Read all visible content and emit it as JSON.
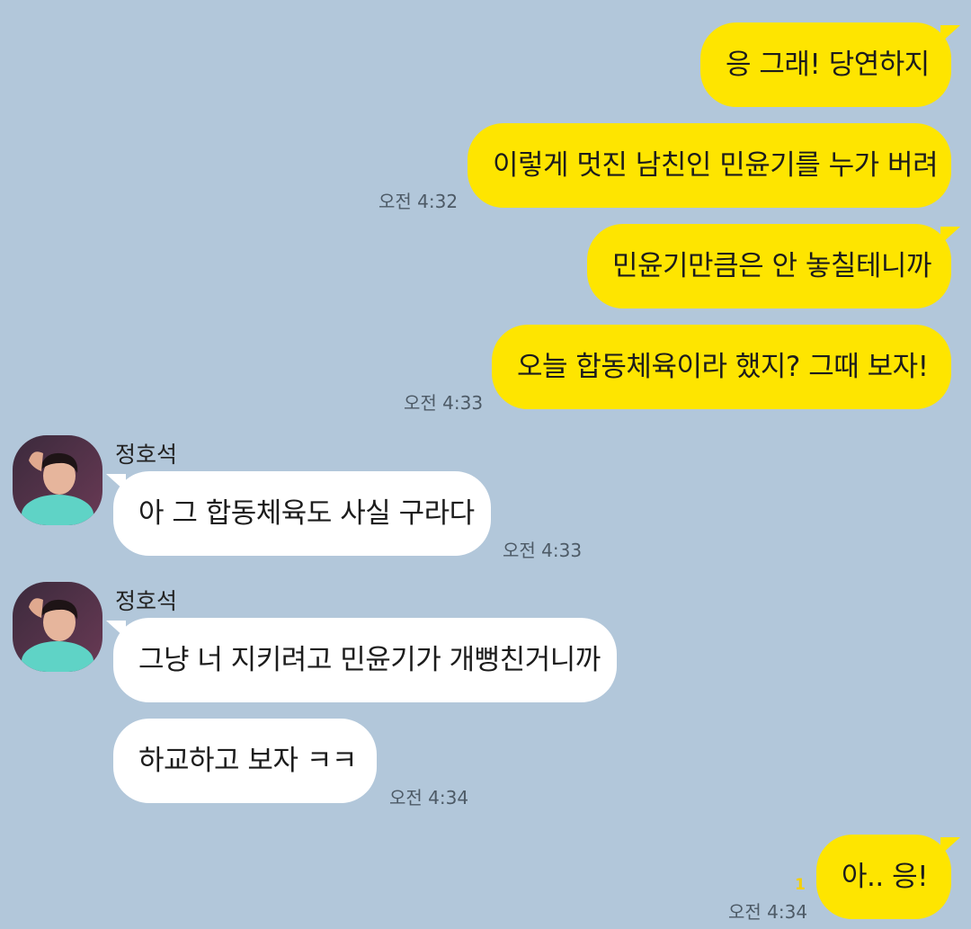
{
  "messages": {
    "m1": {
      "text": "응 그래!  당연하지"
    },
    "m2": {
      "text": "이렇게 멋진 남친인 민윤기를 누가 버려",
      "time": "오전 4:32"
    },
    "m3": {
      "text": "민윤기만큼은 안 놓칠테니까"
    },
    "m4": {
      "text": "오늘 합동체육이라 했지?  그때 보자!",
      "time": "오전 4:33"
    },
    "m5": {
      "sender": "정호석",
      "text": "아 그 합동체육도 사실 구라다",
      "time": "오전 4:33"
    },
    "m6": {
      "sender": "정호석",
      "text": "그냥 너 지키려고 민윤기가 개뻥친거니까"
    },
    "m7": {
      "text": "하교하고 보자 ㅋㅋ",
      "time": "오전 4:34"
    },
    "m8": {
      "text": "아.. 응!",
      "time": "오전 4:34",
      "unread": "1"
    }
  },
  "colors": {
    "background": "#b2c7da",
    "outgoing_bubble": "#fee500",
    "incoming_bubble": "#ffffff"
  }
}
